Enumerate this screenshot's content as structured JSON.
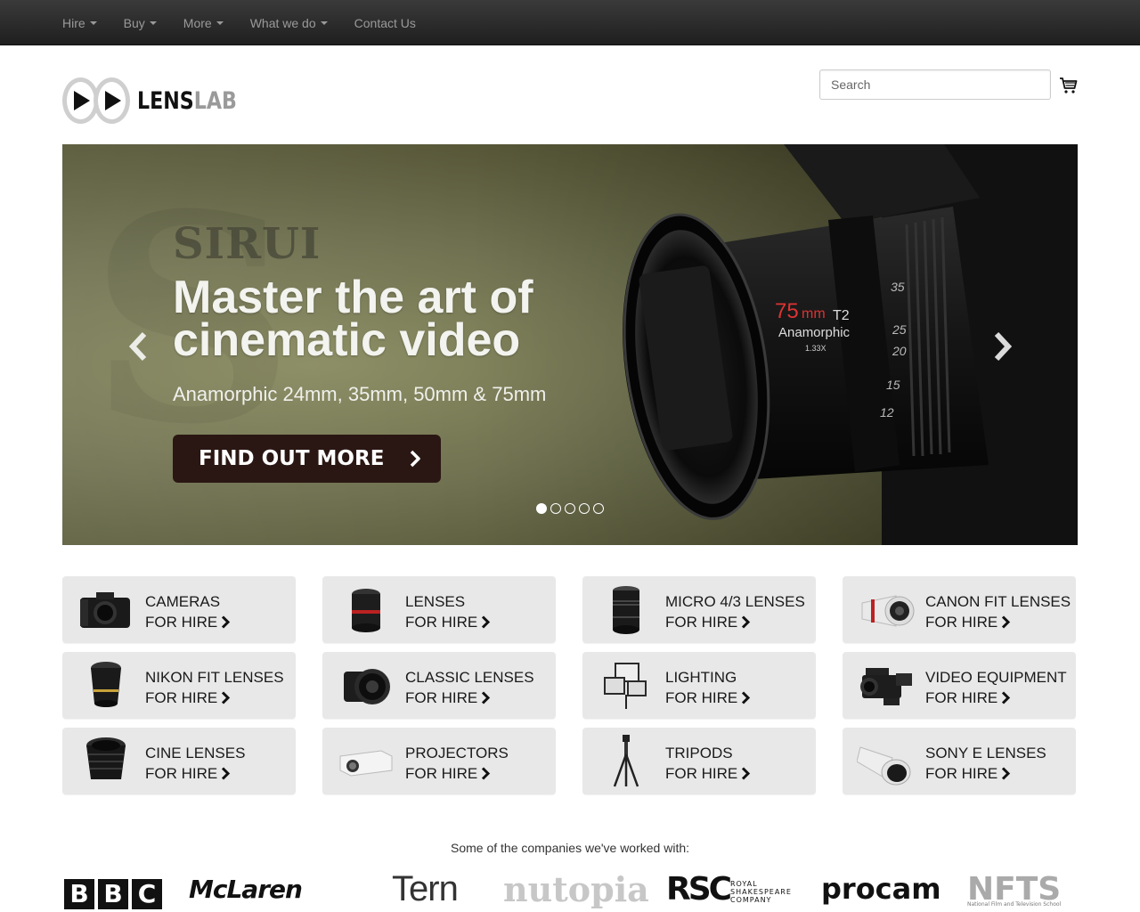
{
  "topnav": {
    "items": [
      {
        "label": "Hire",
        "dropdown": true
      },
      {
        "label": "Buy",
        "dropdown": true
      },
      {
        "label": "More",
        "dropdown": true
      },
      {
        "label": "What we do",
        "dropdown": true
      },
      {
        "label": "Contact Us",
        "dropdown": false
      }
    ]
  },
  "header": {
    "logo": {
      "part1": "LENS",
      "part2": "LAB"
    },
    "search": {
      "placeholder": "Search"
    },
    "cart_icon": "shopping-cart-icon"
  },
  "hero": {
    "brand": "SIRUI",
    "headline": "Master the art of cinematic video",
    "subtitle": "Anamorphic 24mm, 35mm, 50mm & 75mm",
    "cta": "FIND OUT MORE",
    "lens_markings": {
      "focal": "75",
      "unit": "mm",
      "stop": "T2",
      "type": "Anamorphic",
      "squeeze": "1.33X"
    },
    "slide_count": 5,
    "active_slide": 1,
    "prev_icon": "chevron-left-icon",
    "next_icon": "chevron-right-icon"
  },
  "categories": [
    {
      "line1": "CAMERAS",
      "line2": "FOR HIRE",
      "icon": "camera-icon"
    },
    {
      "line1": "LENSES",
      "line2": "FOR HIRE",
      "icon": "lens-icon"
    },
    {
      "line1": "MICRO 4/3 LENSES",
      "line2": "FOR HIRE",
      "icon": "micro-lens-icon"
    },
    {
      "line1": "CANON FIT LENSES",
      "line2": "FOR HIRE",
      "icon": "telephoto-lens-icon"
    },
    {
      "line1": "NIKON FIT LENSES",
      "line2": "FOR HIRE",
      "icon": "wide-lens-icon"
    },
    {
      "line1": "CLASSIC LENSES",
      "line2": "FOR HIRE",
      "icon": "classic-lens-icon"
    },
    {
      "line1": "LIGHTING",
      "line2": "FOR HIRE",
      "icon": "light-panel-icon"
    },
    {
      "line1": "VIDEO EQUIPMENT",
      "line2": "FOR HIRE",
      "icon": "camcorder-icon"
    },
    {
      "line1": "CINE LENSES",
      "line2": "FOR HIRE",
      "icon": "cine-lens-icon"
    },
    {
      "line1": "PROJECTORS",
      "line2": "FOR HIRE",
      "icon": "projector-icon"
    },
    {
      "line1": "TRIPODS",
      "line2": "FOR HIRE",
      "icon": "tripod-icon"
    },
    {
      "line1": "SONY E LENSES",
      "line2": "FOR HIRE",
      "icon": "white-telephoto-icon"
    }
  ],
  "clients": {
    "title": "Some of the companies we've worked with:",
    "logos": {
      "bbc": [
        "B",
        "B",
        "C"
      ],
      "mclaren": "McLaren",
      "tern": "Tern",
      "nutopia": "nutopia",
      "rsc": "RSC",
      "rsc_sub": [
        "ROYAL",
        "SHAKESPEARE",
        "COMPANY"
      ],
      "procam": "procam",
      "nfts": "NFTS",
      "nfts_sub": "National Film and Television School"
    }
  },
  "colors": {
    "nav_bg": "#2b2b2b",
    "nav_text": "#9a9a9a",
    "cta_bg": "#2a1713",
    "tile_bg": "#e8e8e8"
  }
}
